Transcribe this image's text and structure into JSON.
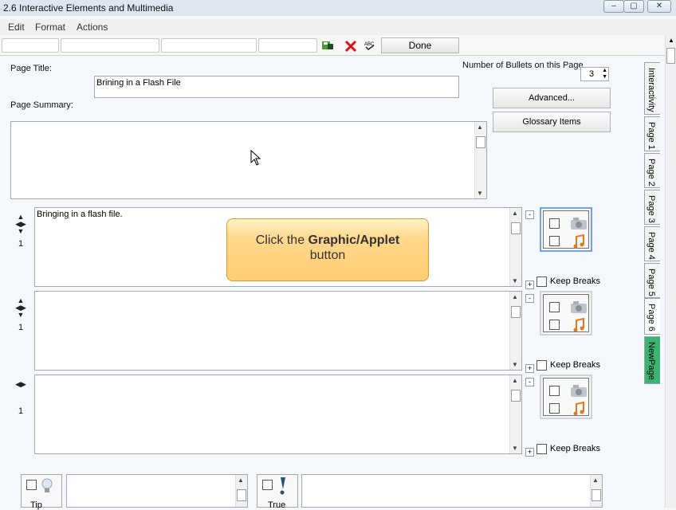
{
  "window": {
    "title": "2.6 Interactive Elements and Multimedia"
  },
  "menu": {
    "items": [
      "Edit",
      "Format",
      "Actions"
    ]
  },
  "toolbar": {
    "done_label": "Done"
  },
  "page": {
    "title_label": "Page Title:",
    "title_value": "Brining in a Flash File",
    "summary_label": "Page Summary:",
    "bullets_label": "Number of Bullets on this Page",
    "bullets_value": "3",
    "advanced_label": "Advanced...",
    "glossary_label": "Glossary Items"
  },
  "bullets": [
    {
      "number": "1",
      "text": "Bringing in a flash file.",
      "keep_breaks": "Keep Breaks"
    },
    {
      "number": "1",
      "text": "",
      "keep_breaks": "Keep Breaks"
    },
    {
      "number": "1",
      "text": "",
      "keep_breaks": "Keep Breaks"
    }
  ],
  "tooltip": {
    "prefix": "Click the ",
    "bold": "Graphic/Applet",
    "line2": "button"
  },
  "tabs": [
    "Interactivity",
    "Page 1",
    "Page 2",
    "Page 3",
    "Page 4",
    "Page 5",
    "Page 6",
    "NewPage"
  ],
  "bottom": {
    "tip_label": "Tip",
    "true_label": "True"
  },
  "colors": {
    "newpage_tab": "#3cb371",
    "tooltip_fill": "#ffcd72",
    "selected_border": "#6ea4e6"
  }
}
